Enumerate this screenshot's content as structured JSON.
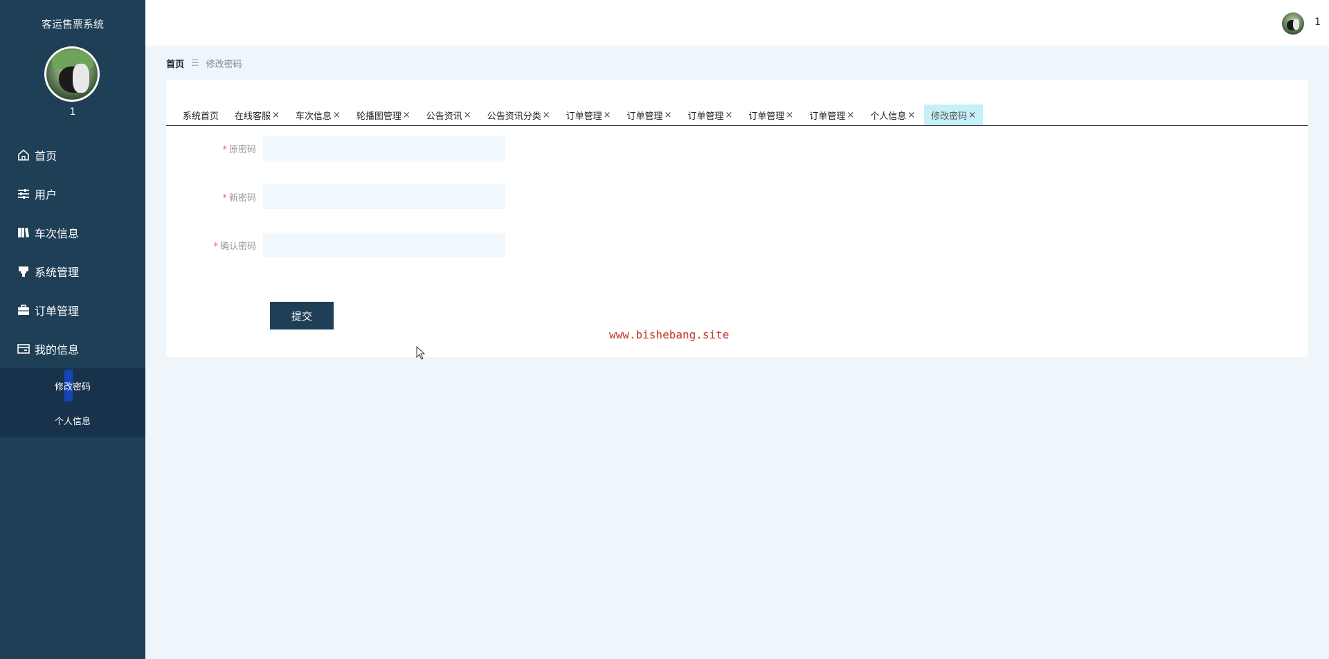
{
  "app": {
    "title": "客运售票系统",
    "username": "1"
  },
  "sidebar": {
    "items": [
      {
        "label": "首页",
        "icon": "home-icon"
      },
      {
        "label": "用户",
        "icon": "sliders-icon"
      },
      {
        "label": "车次信息",
        "icon": "book-icon"
      },
      {
        "label": "系统管理",
        "icon": "stamp-icon"
      },
      {
        "label": "订单管理",
        "icon": "briefcase-icon"
      },
      {
        "label": "我的信息",
        "icon": "id-card-icon"
      }
    ],
    "submenu": [
      {
        "label": "修改密码",
        "active": true
      },
      {
        "label": "个人信息",
        "active": false
      }
    ]
  },
  "topbar": {
    "username": "1"
  },
  "breadcrumb": {
    "home": "首页",
    "separator": "☰",
    "current": "修改密码"
  },
  "tabs": [
    {
      "label": "系统首页",
      "closable": false
    },
    {
      "label": "在线客服",
      "closable": true
    },
    {
      "label": "车次信息",
      "closable": true
    },
    {
      "label": "轮播图管理",
      "closable": true
    },
    {
      "label": "公告资讯",
      "closable": true
    },
    {
      "label": "公告资讯分类",
      "closable": true
    },
    {
      "label": "订单管理",
      "closable": true
    },
    {
      "label": "订单管理",
      "closable": true
    },
    {
      "label": "订单管理",
      "closable": true
    },
    {
      "label": "订单管理",
      "closable": true
    },
    {
      "label": "订单管理",
      "closable": true
    },
    {
      "label": "个人信息",
      "closable": true
    },
    {
      "label": "修改密码",
      "closable": true,
      "active": true
    }
  ],
  "form": {
    "required_mark": "*",
    "old_password": {
      "label": "原密码",
      "value": ""
    },
    "new_password": {
      "label": "新密码",
      "value": ""
    },
    "confirm_password": {
      "label": "确认密码",
      "value": ""
    },
    "submit_label": "提交"
  },
  "watermark": "www.bishebang.site",
  "colors": {
    "sidebar": "#1f3f57",
    "active_tab": "#c5f0f7",
    "submit": "#1f3f57",
    "watermark": "#c0392b"
  }
}
